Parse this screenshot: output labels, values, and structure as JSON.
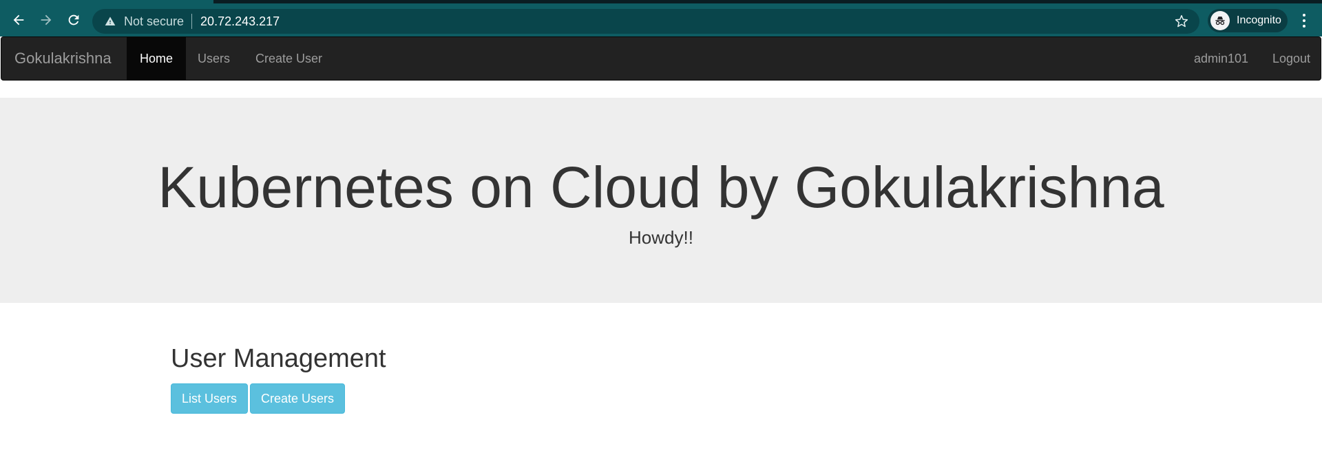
{
  "browser": {
    "security_label": "Not secure",
    "url": "20.72.243.217",
    "profile_label": "Incognito",
    "icons": {
      "back": "arrow-left-icon",
      "forward": "arrow-right-icon",
      "reload": "reload-icon",
      "security": "warning-icon",
      "bookmark": "star-icon",
      "profile": "incognito-icon",
      "menu": "kebab-menu-icon"
    }
  },
  "navbar": {
    "brand": "Gokulakrishna",
    "links": [
      {
        "label": "Home",
        "active": true
      },
      {
        "label": "Users",
        "active": false
      },
      {
        "label": "Create User",
        "active": false
      }
    ],
    "user": "admin101",
    "logout": "Logout"
  },
  "jumbotron": {
    "title": "Kubernetes on Cloud by Gokulakrishna",
    "subtitle": "Howdy!!"
  },
  "main": {
    "section_title": "User Management",
    "buttons": {
      "list_users": "List Users",
      "create_users": "Create Users"
    }
  },
  "colors": {
    "browser_toolbar": "#0e5c62",
    "navbar_bg": "#222222",
    "navbar_active": "#080808",
    "jumbotron_bg": "#eeeeee",
    "button_info": "#5bc0de"
  }
}
